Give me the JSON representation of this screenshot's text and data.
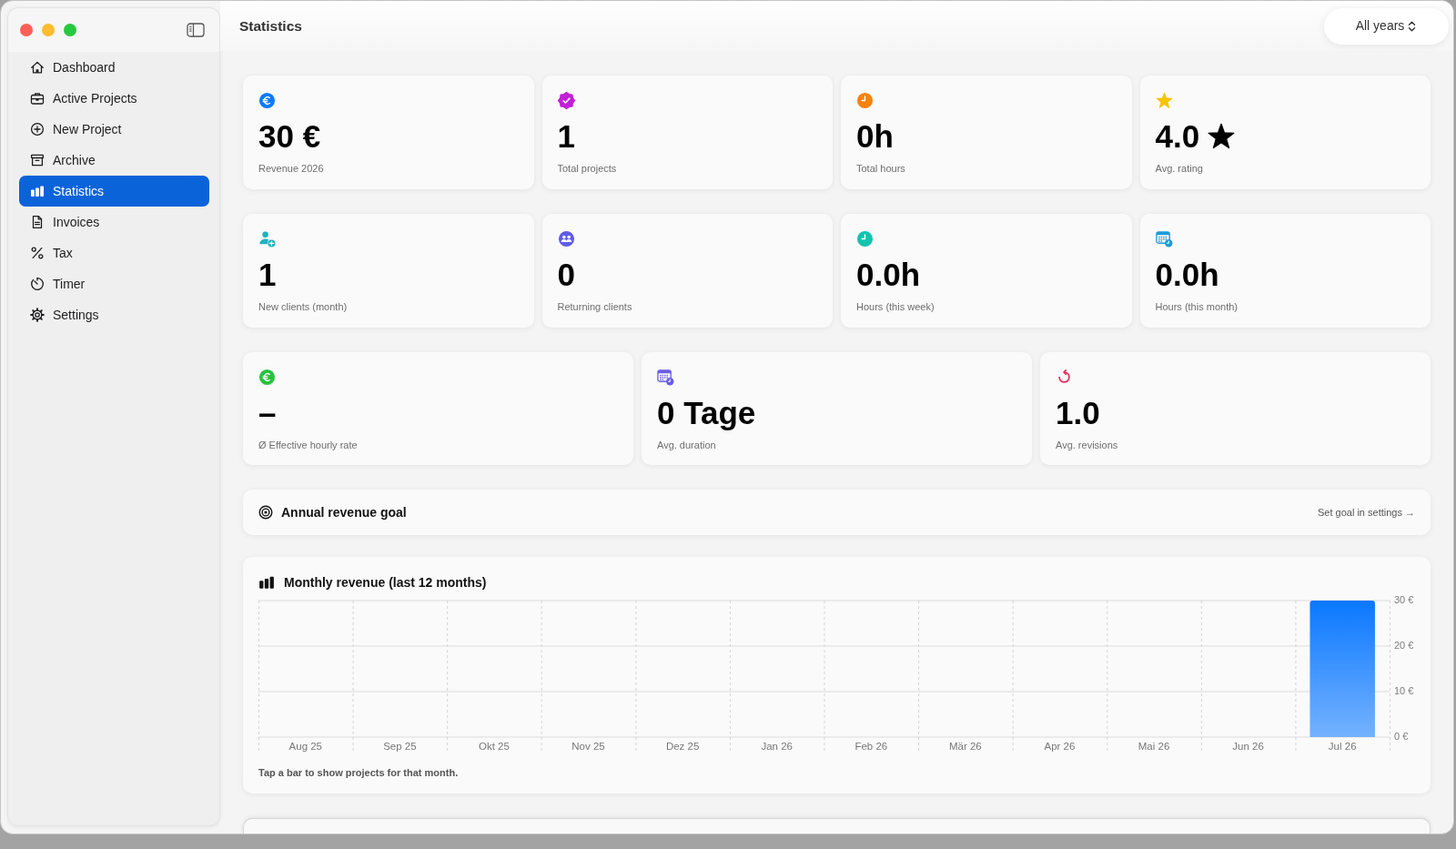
{
  "toolbar": {
    "title": "Statistics",
    "year_filter": "All years"
  },
  "sidebar": {
    "items": [
      {
        "label": "Dashboard",
        "selected": false
      },
      {
        "label": "Active Projects",
        "selected": false
      },
      {
        "label": "New Project",
        "selected": false
      },
      {
        "label": "Archive",
        "selected": false
      },
      {
        "label": "Statistics",
        "selected": true
      },
      {
        "label": "Invoices",
        "selected": false
      },
      {
        "label": "Tax",
        "selected": false
      },
      {
        "label": "Timer",
        "selected": false
      },
      {
        "label": "Settings",
        "selected": false
      }
    ]
  },
  "stat_rows": [
    {
      "cards": [
        {
          "kind": "plain",
          "value": "30 €",
          "label": "Revenue 2026"
        },
        {
          "kind": "plain",
          "value": "1",
          "label": "Total projects"
        },
        {
          "kind": "plain",
          "value": "0h",
          "label": "Total hours"
        },
        {
          "kind": "rating",
          "value": "4.0",
          "label": "Avg. rating"
        }
      ]
    },
    {
      "cards": [
        {
          "kind": "plain",
          "value": "1",
          "label": "New clients (month)"
        },
        {
          "kind": "plain",
          "value": "0",
          "label": "Returning clients"
        },
        {
          "kind": "plain",
          "value": "0.0h",
          "label": "Hours (this week)"
        },
        {
          "kind": "plain",
          "value": "0.0h",
          "label": "Hours (this month)"
        }
      ]
    },
    {
      "cards": [
        {
          "kind": "plain",
          "value": "–",
          "label": "Ø Effective hourly rate"
        },
        {
          "kind": "plain",
          "value": "0 Tage",
          "label": "Avg. duration"
        },
        {
          "kind": "plain",
          "value": "1.0",
          "label": "Avg. revisions"
        }
      ]
    }
  ],
  "goal": {
    "title": "Annual revenue goal",
    "link": "Set goal in settings →"
  },
  "revenue_chart": {
    "title": "Monthly revenue (last 12 months)",
    "chart_data": {
      "type": "bar",
      "categories": [
        "Aug 25",
        "Sep 25",
        "Okt 25",
        "Nov 25",
        "Dez 25",
        "Jan 26",
        "Feb 26",
        "Mär 26",
        "Apr 26",
        "Mai 26",
        "Jun 26",
        "Jul 26"
      ],
      "values": [
        0,
        0,
        0,
        0,
        0,
        0,
        0,
        0,
        0,
        0,
        0,
        30
      ],
      "ylim": [
        0,
        30
      ],
      "yticks": [
        {
          "value": 0,
          "label": "0 €"
        },
        {
          "value": 10,
          "label": "10 €"
        },
        {
          "value": 20,
          "label": "20 €"
        },
        {
          "value": 30,
          "label": "30 €"
        }
      ]
    },
    "hint": "Tap a bar to show projects for that month."
  }
}
